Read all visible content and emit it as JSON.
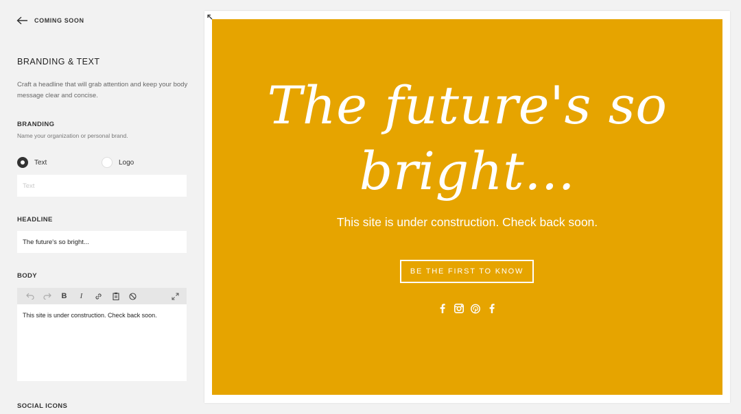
{
  "nav": {
    "back_label": "COMING SOON"
  },
  "panel": {
    "title": "BRANDING & TEXT",
    "description": "Craft a headline that will grab attention and keep your body message clear and concise."
  },
  "branding": {
    "label": "BRANDING",
    "hint": "Name your organization or personal brand.",
    "options": [
      {
        "label": "Text",
        "selected": true
      },
      {
        "label": "Logo",
        "selected": false
      }
    ],
    "text_value": "",
    "text_placeholder": "Text"
  },
  "headline": {
    "label": "HEADLINE",
    "value": "The future's so bright..."
  },
  "body": {
    "label": "BODY",
    "toolbar": [
      "undo-icon",
      "redo-icon",
      "bold-icon",
      "italic-icon",
      "link-icon",
      "paste-icon",
      "clear-format-icon",
      "expand-icon"
    ],
    "value": "This site is under construction. Check back soon."
  },
  "social": {
    "label": "SOCIAL ICONS"
  },
  "preview": {
    "background": "#e6a400",
    "headline": "The future's so bright...",
    "subtext": "This site is under construction. Check back soon.",
    "cta_label": "BE THE FIRST TO KNOW",
    "social_icons": [
      "facebook-icon",
      "instagram-icon",
      "pinterest-icon",
      "facebook-icon"
    ]
  }
}
